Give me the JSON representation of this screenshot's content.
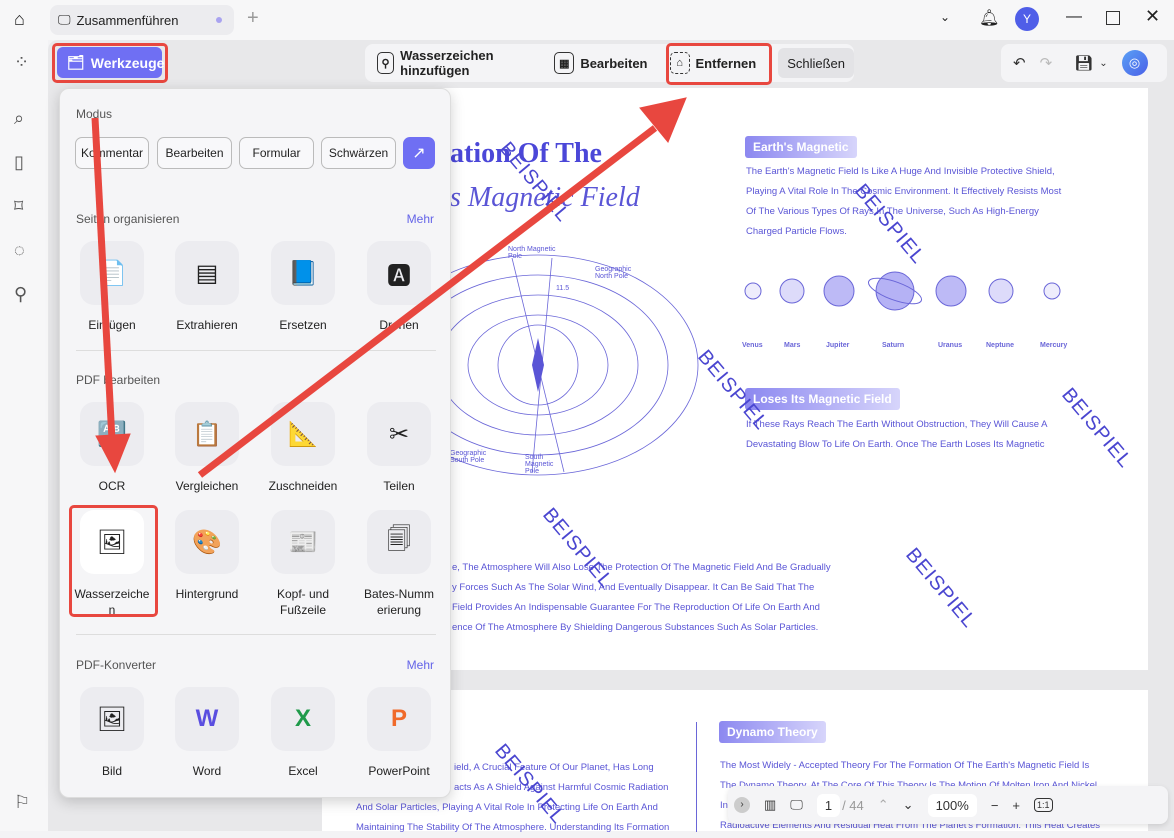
{
  "tab": {
    "title": "Zusammenführen",
    "new_tab": "+"
  },
  "window": {
    "avatar": "Y"
  },
  "tools_button": "Werkzeuge",
  "toolbar": {
    "add_watermark": "Wasserzeichen hinzufügen",
    "edit": "Bearbeiten",
    "remove": "Entfernen",
    "close": "Schließen"
  },
  "panel": {
    "mode_label": "Modus",
    "modes": [
      "Kommentar",
      "Bearbeiten",
      "Formular",
      "Schwärzen"
    ],
    "organize": {
      "label": "Seiten organisieren",
      "more": "Mehr",
      "items": [
        "Einfügen",
        "Extrahieren",
        "Ersetzen",
        "Drehen"
      ]
    },
    "edit": {
      "label": "PDF bearbeiten",
      "items": [
        "OCR",
        "Vergleichen",
        "Zuschneiden",
        "Teilen",
        "Wasserzeichen",
        "Hintergrund",
        "Kopf- und Fußzeile",
        "Bates-Nummerierung"
      ]
    },
    "convert": {
      "label": "PDF-Konverter",
      "more": "Mehr",
      "items": [
        "Bild",
        "Word",
        "Excel",
        "PowerPoint"
      ]
    }
  },
  "doc": {
    "title1": "ation Of The",
    "title2": "s Magnetic Field",
    "watermark": "BEISPIEL",
    "diagram": {
      "north_mag": "North Magnetic Pole",
      "geo_north": "Geographic North Pole",
      "geo_south": "Geographic South Pole",
      "south_mag": "South Magnetic Pole",
      "angle": "11.5"
    },
    "earth_badge": "Earth's Magnetic",
    "earth_text": [
      "The Earth's Magnetic Field Is Like A Huge And Invisible Protective Shield,",
      "Playing A Vital Role In The Cosmic Environment. It Effectively Resists Most",
      "Of The Various Types Of Rays In The Universe, Such As High-Energy",
      "Charged Particle Flows."
    ],
    "planets": [
      "Venus",
      "Mars",
      "Jupiter",
      "Saturn",
      "Uranus",
      "Neptune",
      "Mercury"
    ],
    "loses_badge": "Loses Its Magnetic Field",
    "loses_text": [
      "If These Rays Reach The Earth Without Obstruction, They Will Cause A",
      "Devastating Blow To Life On Earth. Once The Earth Loses Its Magnetic"
    ],
    "left_text": [
      "e, The Atmosphere Will Also Lose The Protection Of The Magnetic Field And Be Gradually",
      "y Forces Such As The Solar Wind, And Eventually Disappear. It Can Be Said That The",
      "Field Provides An Indispensable Guarantee For The Reproduction Of Life On Earth And",
      "ence Of The Atmosphere By Shielding Dangerous Substances Such As Solar Particles."
    ],
    "p2_left": [
      "ield, A Crucial Feature Of Our Planet, Has Long",
      "acts As A Shield Against Harmful Cosmic Radiation",
      "And Solar Particles, Playing A Vital Role In Protecting Life On Earth And",
      "Maintaining The Stability Of The Atmosphere. Understanding Its Formation"
    ],
    "dynamo_badge": "Dynamo Theory",
    "p2_right": [
      "The Most Widely - Accepted Theory For The Formation Of The Earth's Magnetic Field Is",
      "The Dynamo Theory. At The Core Of This Theory Is The Motion Of Molten Iron And Nickel",
      "In",
      "Radioactive Elements And Residual Heat From The Planet's Formation. This Heat Creates"
    ]
  },
  "nav": {
    "page": "1",
    "total": "/ 44",
    "zoom": "100%",
    "fit": "1:1"
  },
  "colors": {
    "accent": "#6f6ff3",
    "annotation": "#e8473f",
    "doc_text": "#5a55d6"
  }
}
